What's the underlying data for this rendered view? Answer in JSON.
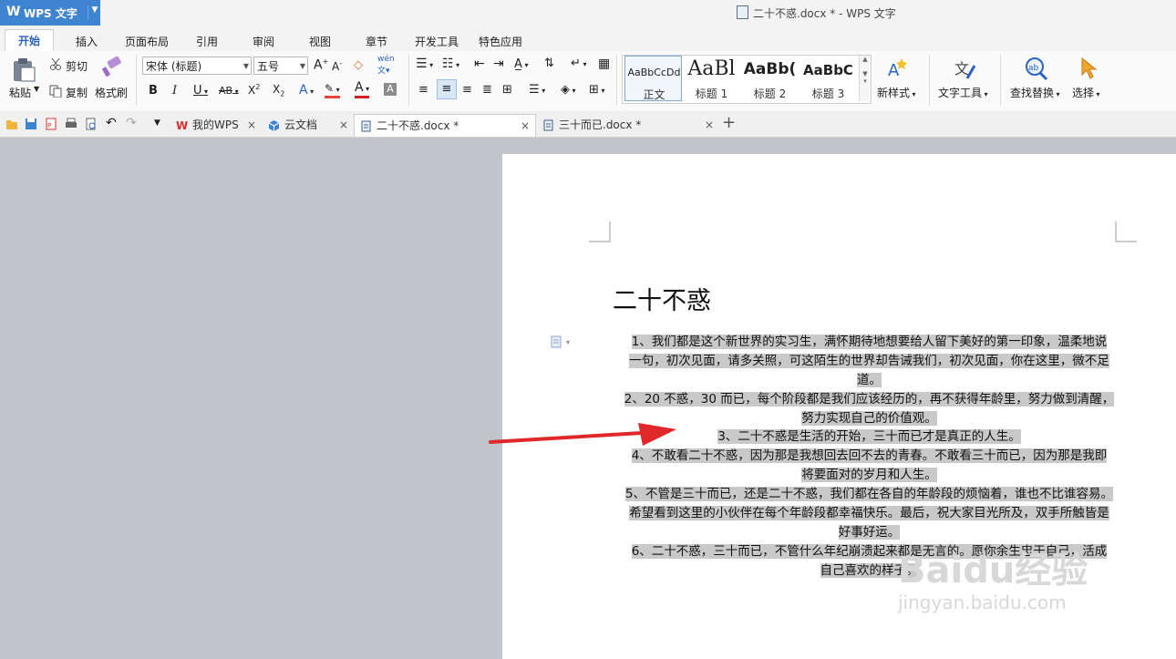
{
  "app": {
    "name": "WPS 文字",
    "window_title": "二十不惑.docx * - WPS 文字"
  },
  "menu": [
    "开始",
    "插入",
    "页面布局",
    "引用",
    "审阅",
    "视图",
    "章节",
    "开发工具",
    "特色应用"
  ],
  "ribbon": {
    "paste": "粘贴",
    "cut": "剪切",
    "copy": "复制",
    "format_painter": "格式刷",
    "font_name": "宋体 (标题)",
    "font_size": "五号",
    "styles": [
      {
        "preview": "AaBbCcDd",
        "name": "正文"
      },
      {
        "preview": "AaBl",
        "name": "标题 1"
      },
      {
        "preview": "AaBb(",
        "name": "标题 2"
      },
      {
        "preview": "AaBbC",
        "name": "标题 3"
      }
    ],
    "new_style": "新样式",
    "text_tools": "文字工具",
    "find_replace": "查找替换",
    "select": "选择"
  },
  "tabs": [
    {
      "label": "我的WPS"
    },
    {
      "label": "云文档"
    },
    {
      "label": "二十不惑.docx *"
    },
    {
      "label": "三十而已.docx *"
    }
  ],
  "document": {
    "title": "二十不惑",
    "paragraphs": [
      [
        "1、我们都是这个新世界的实习生，满怀期待地想要给人留下美好的第一印象，温柔地说",
        "一句，初次见面，请多关照，可这陌生的世界却告诫我们，初次见面，你在这里，微不足",
        "道。"
      ],
      [
        "2、20 不惑，30 而已，每个阶段都是我们应该经历的，再不获得年龄里，努力做到清醒，",
        "努力实现自己的价值观。"
      ],
      [
        "3、二十不惑是生活的开始，三十而已才是真正的人生。"
      ],
      [
        "4、不敢看二十不惑，因为那是我想回去回不去的青春。不敢看三十而已，因为那是我即",
        "将要面对的岁月和人生。"
      ],
      [
        "5、不管是三十而已，还是二十不惑，我们都在各自的年龄段的烦恼着，谁也不比谁容易。",
        "希望看到这里的小伙伴在每个年龄段都幸福快乐。最后，祝大家目光所及，双手所触皆是",
        "好事好运。"
      ],
      [
        "6、二十不惑，三十而已，不管什么年纪崩溃起来都是无言的。愿你余生忠于自己，活成",
        "自己喜欢的样子。"
      ]
    ]
  },
  "watermark": {
    "brand": "Baidu经验",
    "url": "jingyan.baidu.com"
  },
  "colors": {
    "wps_blue": "#3f84d1",
    "annotation_arrow": "#e0282b",
    "selection": "#c9c9c9"
  }
}
